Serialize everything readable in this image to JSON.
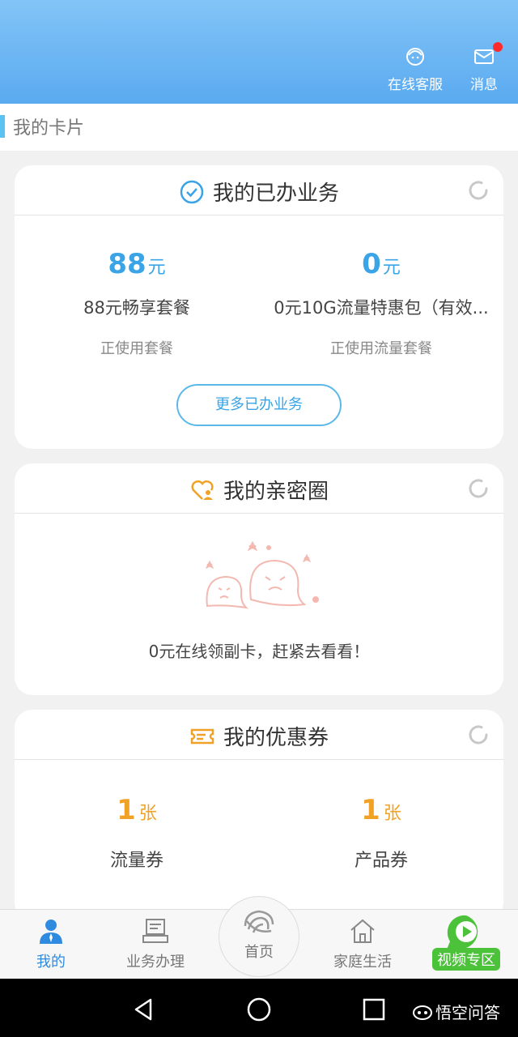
{
  "header": {
    "service_label": "在线客服",
    "message_label": "消息"
  },
  "card_section": {
    "title": "我的卡片"
  },
  "business": {
    "title": "我的已办业务",
    "items": [
      {
        "amount": "88",
        "unit": "元",
        "name": "88元畅享套餐",
        "status": "正使用套餐"
      },
      {
        "amount": "0",
        "unit": "元",
        "name": "0元10G流量特惠包（有效...",
        "status": "正使用流量套餐"
      }
    ],
    "more_button": "更多已办业务"
  },
  "family": {
    "title": "我的亲密圈",
    "empty_text": "0元在线领副卡，赶紧去看看！"
  },
  "coupons": {
    "title": "我的优惠券",
    "items": [
      {
        "count": "1",
        "unit": "张",
        "name": "流量券"
      },
      {
        "count": "1",
        "unit": "张",
        "name": "产品券"
      }
    ]
  },
  "tabbar": {
    "mine": "我的",
    "business": "业务办理",
    "home": "首页",
    "family_life": "家庭生活",
    "video": "视频专区"
  },
  "watermark": "悟空问答",
  "colors": {
    "accent_blue": "#3aa4e6",
    "coupon_orange": "#f0a227",
    "video_green": "#4cc13a",
    "badge_red": "#ff2a2a"
  }
}
